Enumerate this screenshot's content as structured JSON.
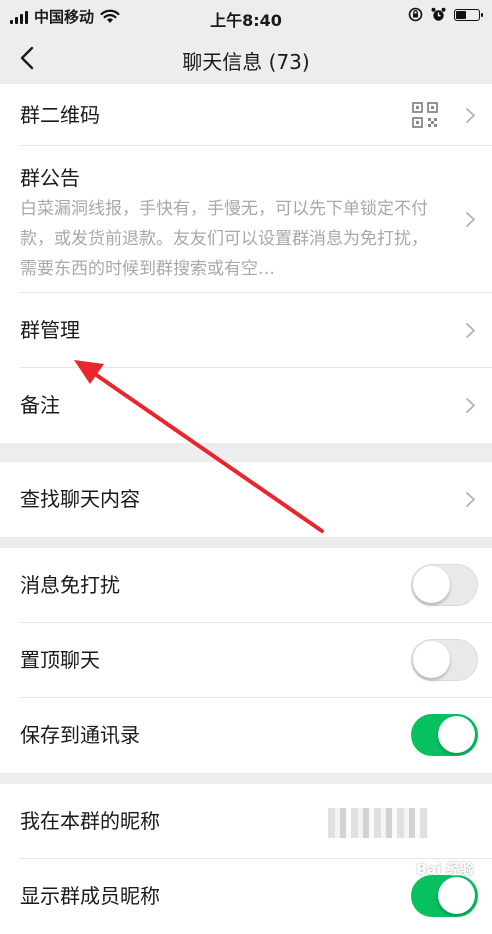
{
  "status_bar": {
    "carrier": "中国移动",
    "time": "上午8:40"
  },
  "nav": {
    "title": "聊天信息 (73)"
  },
  "group1": {
    "qr_label": "群二维码",
    "notice_label": "群公告",
    "notice_text": "白菜漏洞线报，手快有，手慢无，可以先下单锁定不付款，或发货前退款。友友们可以设置群消息为免打扰，需要东西的时候到群搜索或有空…",
    "manage_label": "群管理",
    "remark_label": "备注"
  },
  "group2": {
    "search_label": "查找聊天内容"
  },
  "group3": {
    "mute_label": "消息免打扰",
    "mute_on": false,
    "pin_label": "置顶聊天",
    "pin_on": false,
    "save_label": "保存到通讯录",
    "save_on": true
  },
  "group4": {
    "nickname_label": "我在本群的昵称",
    "show_names_label": "显示群成员昵称",
    "show_names_on": true
  },
  "colors": {
    "accent_green": "#07c160",
    "annotation_red": "#e8262b"
  },
  "watermark": "Bai 经验"
}
